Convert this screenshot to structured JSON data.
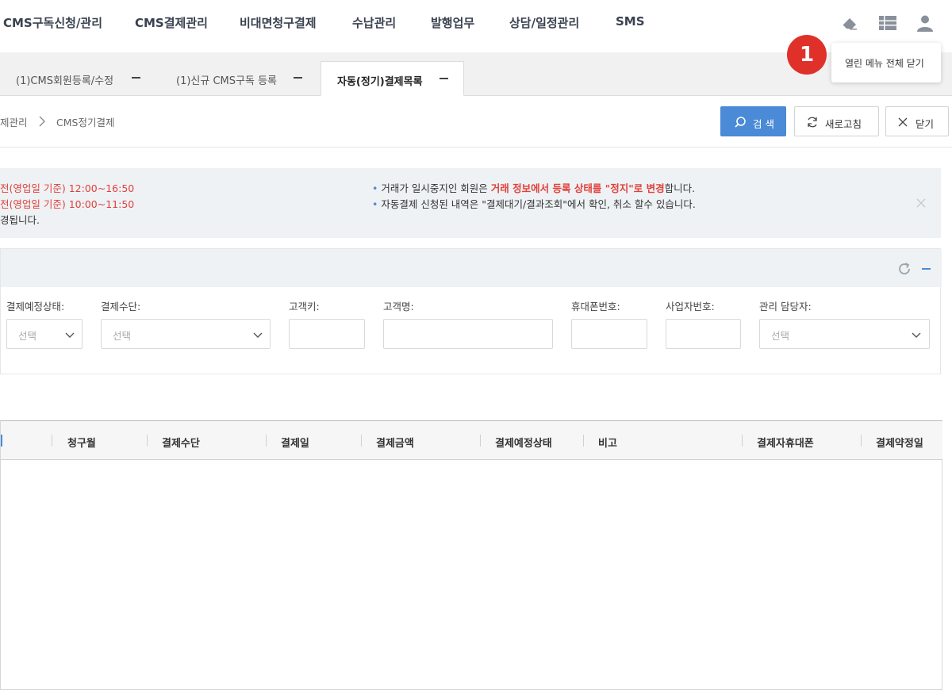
{
  "nav": {
    "items": [
      "CMS구독신청/관리",
      "CMS결제관리",
      "비대면청구결제",
      "수납관리",
      "발행업무",
      "상담/일정관리",
      "SMS"
    ],
    "icons": [
      "eraser-icon",
      "grid-list-icon",
      "user-icon"
    ]
  },
  "tabs": [
    {
      "label": "(1)CMS회원등록/수정",
      "active": false
    },
    {
      "label": "(1)신규 CMS구독 등록",
      "active": false
    },
    {
      "label": "자동(정기)결제목록",
      "active": true
    }
  ],
  "tooltip": {
    "badge": "1",
    "text": "열린 메뉴 전체 닫기"
  },
  "breadcrumb": {
    "parent": "제관리",
    "current": "CMS정기결제"
  },
  "toolbar": {
    "search": "검 색",
    "refresh": "새로고침",
    "close": "닫기"
  },
  "notice": {
    "left": [
      {
        "text": "전(영업일 기준) 12:00~16:50",
        "color": "#e2403a"
      },
      {
        "text": "전(영업일 기준) 10:00~11:50",
        "color": "#e2403a"
      },
      {
        "text": "경됩니다.",
        "color": "#333333"
      }
    ],
    "right1": {
      "pre": "거래가 일시중지인 회원은 ",
      "emph": "거래 정보에서 등록 상태를 \"정지\"로 변경",
      "post": "합니다."
    },
    "right2": "자동결제 신청된 내역은 \"결제대기/결과조회\"에서 확인, 취소 할수 있습니다."
  },
  "filters": {
    "labels": [
      "결제예정상태:",
      "결제수단:",
      "고객키:",
      "고객명:",
      "휴대폰번호:",
      "사업자번호:",
      "관리 담당자:"
    ],
    "select_placeholder": "선택"
  },
  "table": {
    "columns": [
      "청구월",
      "결제수단",
      "결제일",
      "결제금액",
      "결제예정상태",
      "비고",
      "결제자휴대폰",
      "결제약정일"
    ]
  },
  "colors": {
    "accent": "#4a8ad6",
    "alert": "#e2403a",
    "badge": "#e0302a"
  }
}
